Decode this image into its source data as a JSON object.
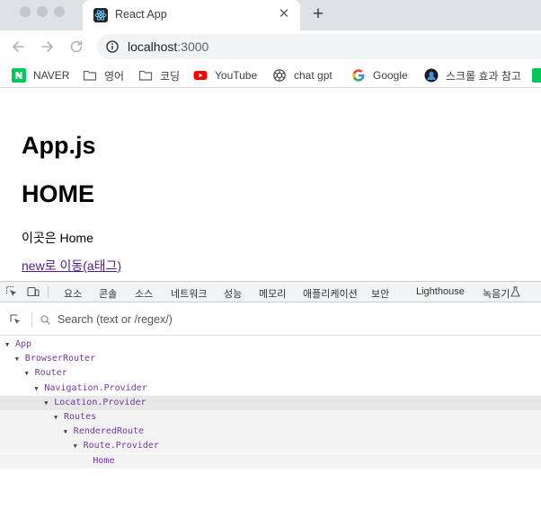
{
  "browser": {
    "tab": {
      "title": "React App",
      "close_glyph": "✕",
      "favicon": "react-icon"
    },
    "new_tab_glyph": "+",
    "url_host": "localhost",
    "url_port": ":3000",
    "bookmarks": [
      {
        "label": "NAVER",
        "icon": "naver-icon"
      },
      {
        "label": "영어",
        "icon": "folder-icon"
      },
      {
        "label": "코딩",
        "icon": "folder-icon"
      },
      {
        "label": "YouTube",
        "icon": "youtube-icon"
      },
      {
        "label": "chat gpt",
        "icon": "openai-icon"
      },
      {
        "label": "Google",
        "icon": "google-icon"
      },
      {
        "label": "스크롤 효과 참고",
        "icon": "avatar-icon"
      }
    ]
  },
  "page": {
    "heading1": "App.js",
    "heading2": "HOME",
    "paragraph": "이곳은 Home",
    "link": "new로 이동(a태그)"
  },
  "devtools": {
    "tabs": [
      "요소",
      "콘솔",
      "소스",
      "네트워크",
      "성능",
      "메모리",
      "애플리케이션",
      "보안",
      "Lighthouse",
      "녹음기"
    ],
    "search_placeholder": "Search (text or /regex/)",
    "tree": [
      {
        "name": "App",
        "depth": 0,
        "state": "normal"
      },
      {
        "name": "BrowserRouter",
        "depth": 1,
        "state": "normal"
      },
      {
        "name": "Router",
        "depth": 2,
        "state": "normal"
      },
      {
        "name": "Navigation.Provider",
        "depth": 3,
        "state": "normal"
      },
      {
        "name": "Location.Provider",
        "depth": 4,
        "state": "selected"
      },
      {
        "name": "Routes",
        "depth": 5,
        "state": "child"
      },
      {
        "name": "RenderedRoute",
        "depth": 6,
        "state": "child"
      },
      {
        "name": "Route.Provider",
        "depth": 7,
        "state": "child"
      },
      {
        "name": "Home",
        "depth": 8,
        "state": "child"
      }
    ]
  },
  "colors": {
    "link_visited": "#551a8b",
    "tree_component": "#6f3aa6",
    "tree_selected_bg": "#e7e7e7"
  }
}
